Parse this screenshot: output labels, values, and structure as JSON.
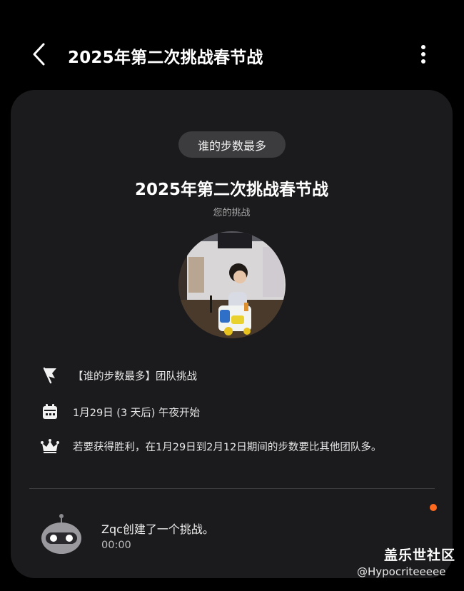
{
  "header": {
    "title": "2025年第二次挑战春节战",
    "back_icon": "chevron-left-icon",
    "more_icon": "more-vertical-icon"
  },
  "challenge": {
    "type_chip": "谁的步数最多",
    "title": "2025年第二次挑战春节战",
    "subtitle": "您的挑战"
  },
  "details": [
    {
      "icon": "flag-icon",
      "text": "【谁的步数最多】团队挑战"
    },
    {
      "icon": "calendar-icon",
      "text": "1月29日 (3 天后) 午夜开始"
    },
    {
      "icon": "crown-icon",
      "text": "若要获得胜利，在1月29日到2月12日期间的步数要比其他团队多。"
    }
  ],
  "activity": {
    "message": "Zqc创建了一个挑战。",
    "time": "00:00",
    "avatar_icon": "robot-avatar-icon",
    "unread_dot_color": "#ff6a1f"
  },
  "watermark": {
    "line1": "盖乐世社区",
    "line2": "@Hypocriteeeee"
  },
  "colors": {
    "background": "#000000",
    "card": "#1b1b1d",
    "chip": "#3c3c3f",
    "accent_dot": "#ff6a1f"
  }
}
